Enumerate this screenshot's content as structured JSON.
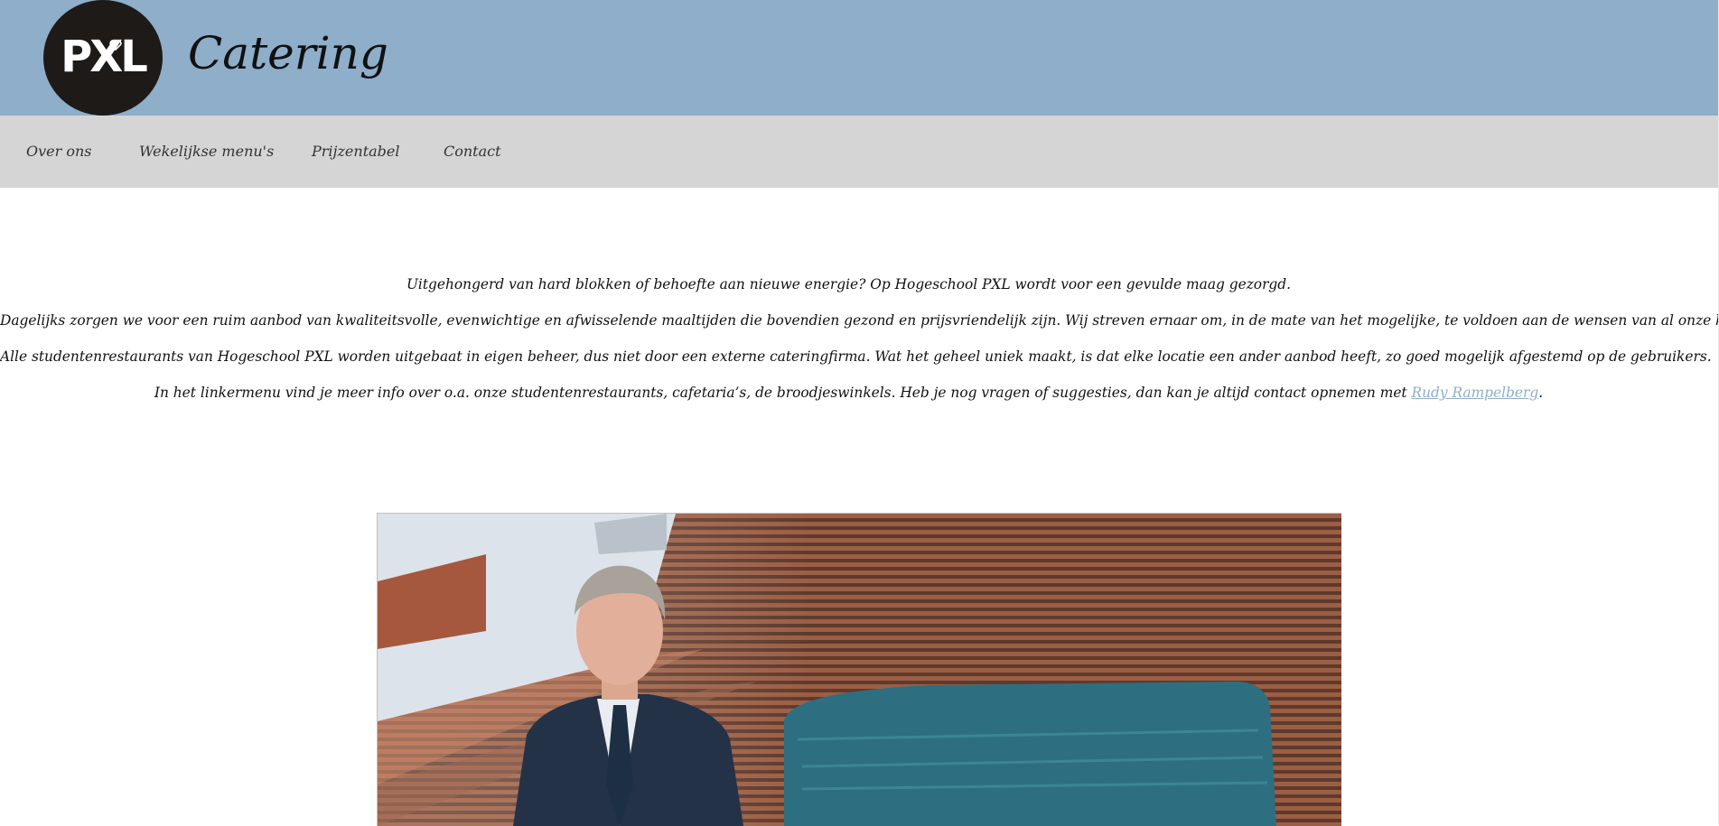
{
  "header": {
    "logo_text": "PXL",
    "title": "Catering"
  },
  "nav": {
    "items": [
      {
        "label": "Over ons"
      },
      {
        "label": "Wekelijkse menu's"
      },
      {
        "label": "Prijzentabel"
      },
      {
        "label": "Contact"
      }
    ]
  },
  "content": {
    "paragraph_1": "Uitgehongerd van hard blokken of behoefte aan nieuwe energie? Op Hogeschool PXL wordt voor een gevulde maag gezorgd.",
    "paragraph_2": "Dagelijks zorgen we voor een ruim aanbod van kwaliteitsvolle, evenwichtige en afwisselende maaltijden die bovendien gezond en prijsvriendelijk zijn. Wij streven ernaar om, in de mate van het mogelijke, te voldoen aan de wensen van al onze klanten.",
    "paragraph_3": "Alle studentenrestaurants van Hogeschool PXL worden uitgebaat in eigen beheer, dus niet door een externe cateringfirma. Wat het geheel uniek maakt, is dat elke locatie een ander aanbod heeft, zo goed mogelijk afgestemd op de gebruikers.",
    "paragraph_4_before": "In het linkermenu vind je meer info over o.a. onze studentenrestaurants, cafetaria’s, de broodjeswinkels. Heb je nog vragen of suggesties, dan kan je altijd contact opnemen met ",
    "contact_link": "Rudy Rampelberg",
    "paragraph_4_after": "."
  },
  "colors": {
    "header_bg": "#8eaec9",
    "nav_bg": "#d5d5d5",
    "logo_bg": "#1d1a18",
    "link": "#8eaec9"
  }
}
